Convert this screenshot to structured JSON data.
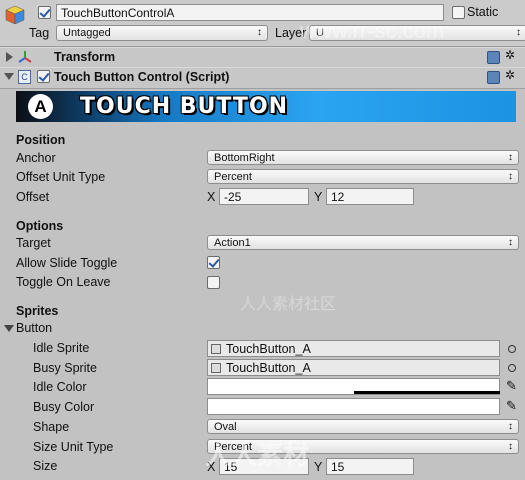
{
  "header": {
    "object_name": "TouchButtonControlA",
    "static_label": "Static",
    "tag_label": "Tag",
    "tag_value": "Untagged",
    "layer_label": "Layer",
    "layer_value": "U",
    "active": true,
    "static_checked": false
  },
  "components": {
    "transform": "Transform",
    "script": "Touch Button Control (Script)"
  },
  "banner": {
    "badge": "A",
    "title": "TOUCH BUTTON"
  },
  "position": {
    "heading": "Position",
    "anchor_label": "Anchor",
    "anchor_value": "BottomRight",
    "offset_unit_label": "Offset Unit Type",
    "offset_unit_value": "Percent",
    "offset_label": "Offset",
    "x_label": "X",
    "x_value": "-25",
    "y_label": "Y",
    "y_value": "12"
  },
  "options": {
    "heading": "Options",
    "target_label": "Target",
    "target_value": "Action1",
    "allow_slide_label": "Allow Slide Toggle",
    "allow_slide_checked": true,
    "toggle_on_leave_label": "Toggle On Leave",
    "toggle_on_leave_checked": false
  },
  "sprites": {
    "heading": "Sprites",
    "button_label": "Button",
    "idle_sprite_label": "Idle Sprite",
    "idle_sprite_value": "TouchButton_A",
    "busy_sprite_label": "Busy Sprite",
    "busy_sprite_value": "TouchButton_A",
    "idle_color_label": "Idle Color",
    "busy_color_label": "Busy Color",
    "shape_label": "Shape",
    "shape_value": "Oval",
    "size_unit_label": "Size Unit Type",
    "size_unit_value": "Percent",
    "size_label": "Size",
    "size_x_label": "X",
    "size_x": "15",
    "size_y_label": "Y",
    "size_y": "15"
  },
  "colors": {
    "banner_blue": "#1c93e3",
    "panel_bg": "#c2c2c2",
    "check_blue": "#2a5aa8"
  },
  "watermarks": [
    "www.rr-sc.com",
    "人人素材社区",
    "人人素材"
  ]
}
